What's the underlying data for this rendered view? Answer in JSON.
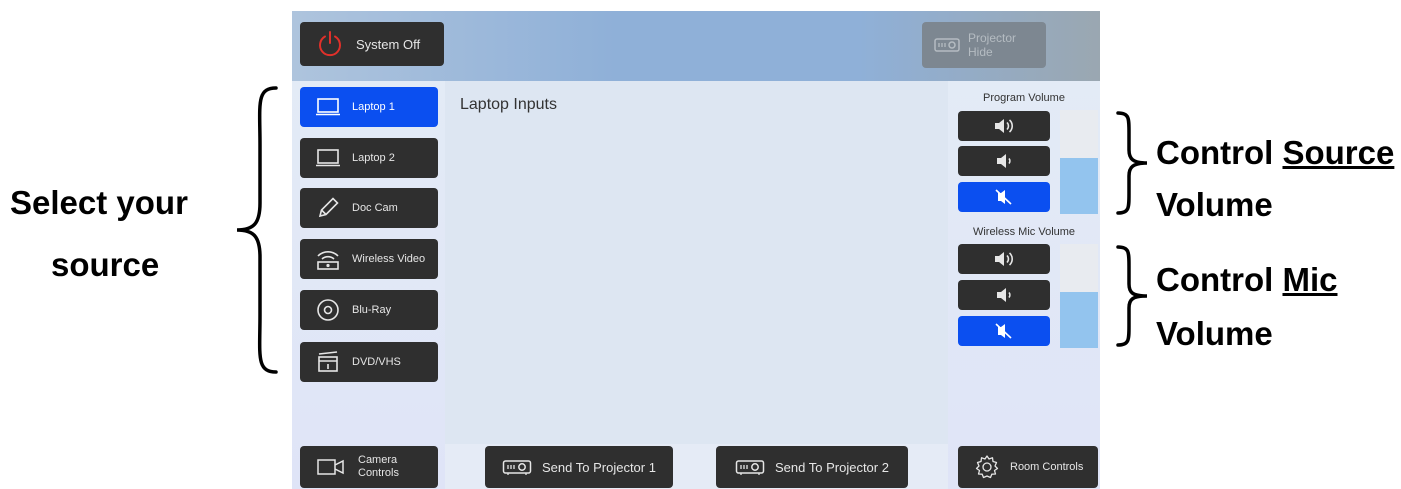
{
  "annotations": {
    "select_source_line1": "Select your",
    "select_source_line2": "source",
    "control_source_prefix": "Control ",
    "control_source_underlined": "Source",
    "control_source_line2": "Volume",
    "control_mic_prefix": "Control ",
    "control_mic_underlined": "Mic",
    "control_mic_line2": "Volume"
  },
  "header": {
    "system_off_label": "System Off",
    "projector_hide_line1": "Projector",
    "projector_hide_line2": "Hide"
  },
  "sources": [
    {
      "label": "Laptop 1",
      "icon": "laptop-icon",
      "active": true
    },
    {
      "label": "Laptop 2",
      "icon": "laptop-icon",
      "active": false
    },
    {
      "label": "Doc Cam",
      "icon": "pencil-icon",
      "active": false
    },
    {
      "label": "Wireless Video",
      "icon": "wireless-icon",
      "active": false
    },
    {
      "label": "Blu-Ray",
      "icon": "disc-icon",
      "active": false
    },
    {
      "label": "DVD/VHS",
      "icon": "dvd-player-icon",
      "active": false
    }
  ],
  "content": {
    "title": "Laptop Inputs"
  },
  "program_volume": {
    "label": "Program Volume",
    "level": 0.54,
    "mute_active": true
  },
  "mic_volume": {
    "label": "Wireless Mic Volume",
    "level": 0.54,
    "mute_active": true
  },
  "footer": {
    "camera_line1": "Camera",
    "camera_line2": "Controls",
    "send_projector_1": "Send To Projector 1",
    "send_projector_2": "Send To Projector 2",
    "room_controls": "Room Controls"
  },
  "colors": {
    "active_blue": "#0b4ff0",
    "button_dark": "#2f2f2f",
    "power_red": "#e0302a",
    "meter_fill": "#93c4ee"
  }
}
